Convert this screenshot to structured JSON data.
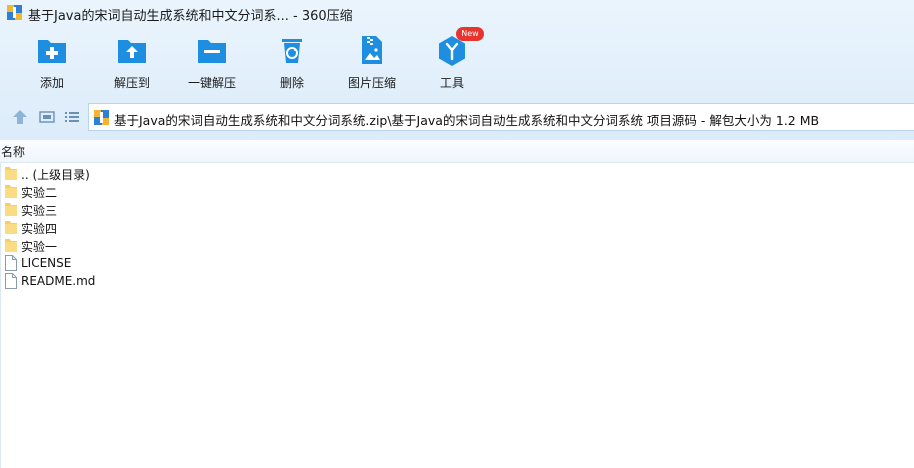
{
  "window": {
    "title": "基于Java的宋词自动生成系统和中文分词系... - 360压缩"
  },
  "toolbar": {
    "add_label": "添加",
    "extract_label": "解压到",
    "oneclick_label": "一键解压",
    "delete_label": "删除",
    "image_compress_label": "图片压缩",
    "tools_label": "工具",
    "new_badge": "New"
  },
  "nav": {
    "address": "基于Java的宋词自动生成系统和中文分词系统.zip\\基于Java的宋词自动生成系统和中文分词系统 项目源码 - 解包大小为 1.2 MB"
  },
  "list": {
    "column_name": "名称",
    "items": [
      {
        "name": ".. (上级目录)",
        "type": "folder"
      },
      {
        "name": "实验二",
        "type": "folder"
      },
      {
        "name": "实验三",
        "type": "folder"
      },
      {
        "name": "实验四",
        "type": "folder"
      },
      {
        "name": "实验一",
        "type": "folder"
      },
      {
        "name": "LICENSE",
        "type": "file"
      },
      {
        "name": "README.md",
        "type": "file"
      }
    ]
  },
  "colors": {
    "toolbar_bg": "#eaf4fd",
    "icon_blue": "#1e8fe0",
    "badge_red": "#e8342f",
    "folder_yellow": "#f7cf62"
  }
}
